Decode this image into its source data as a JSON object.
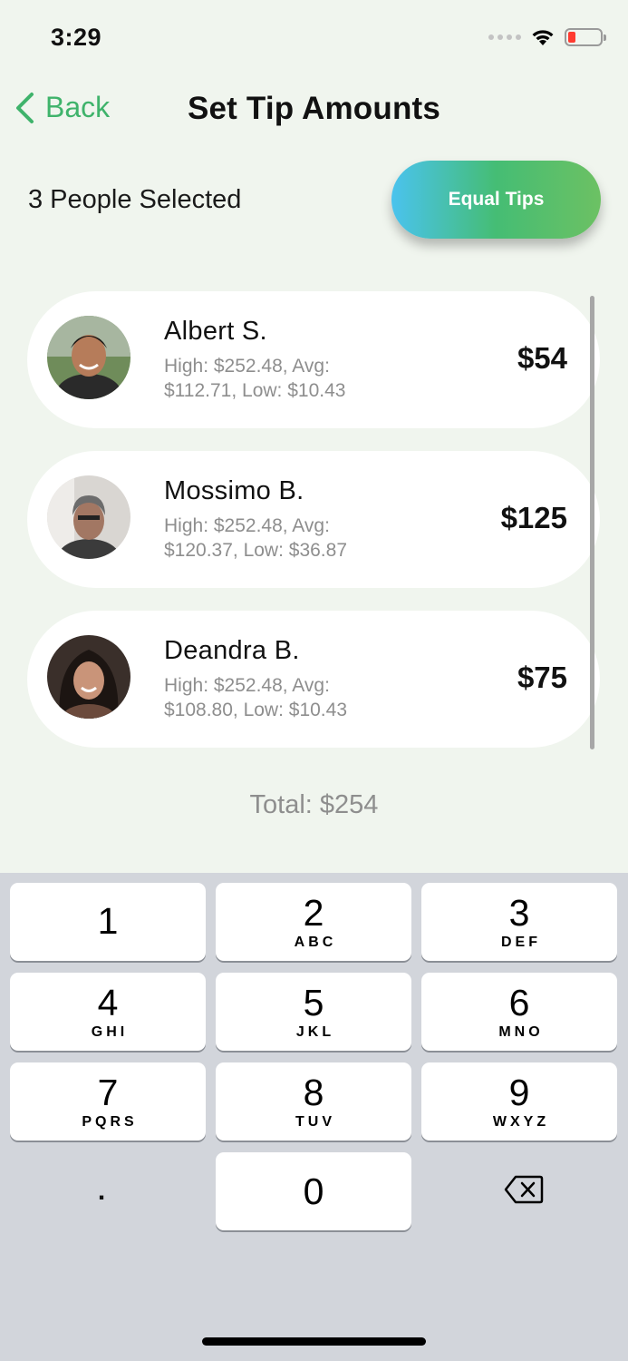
{
  "status_bar": {
    "time": "3:29"
  },
  "nav": {
    "back_label": "Back",
    "title": "Set Tip Amounts"
  },
  "selection": {
    "count_label": "3 People Selected",
    "equal_button": "Equal Tips"
  },
  "people": [
    {
      "name": "Albert S.",
      "stats": "High: $252.48, Avg: $112.71, Low: $10.43",
      "tip": "$54"
    },
    {
      "name": "Mossimo B.",
      "stats": "High: $252.48, Avg: $120.37, Low: $36.87",
      "tip": "$125"
    },
    {
      "name": "Deandra B.",
      "stats": "High: $252.48, Avg: $108.80, Low: $10.43",
      "tip": "$75"
    }
  ],
  "total_label": "Total: $254",
  "keypad": {
    "keys": [
      {
        "digit": "1",
        "letters": ""
      },
      {
        "digit": "2",
        "letters": "ABC"
      },
      {
        "digit": "3",
        "letters": "DEF"
      },
      {
        "digit": "4",
        "letters": "GHI"
      },
      {
        "digit": "5",
        "letters": "JKL"
      },
      {
        "digit": "6",
        "letters": "MNO"
      },
      {
        "digit": "7",
        "letters": "PQRS"
      },
      {
        "digit": "8",
        "letters": "TUV"
      },
      {
        "digit": "9",
        "letters": "WXYZ"
      }
    ],
    "dot": ".",
    "zero": "0"
  },
  "colors": {
    "accent": "#3fb36b",
    "background": "#f0f5ee",
    "keypad_bg": "#d2d5db"
  }
}
